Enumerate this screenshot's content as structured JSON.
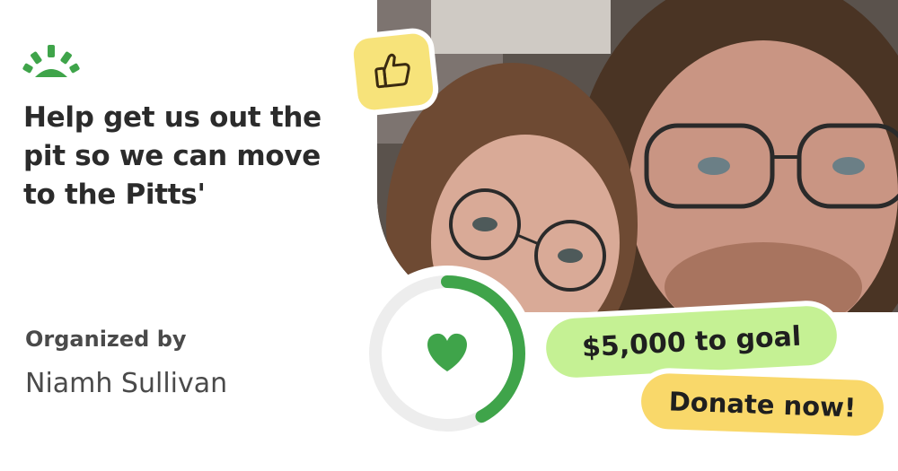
{
  "brand": {
    "logo_icon": "sunrise-logo-icon",
    "accent": "#3fa44a"
  },
  "campaign": {
    "title": "Help get us out the pit so we can move to the Pitts'",
    "organized_by_label": "Organized by",
    "organizer": "Niamh Sullivan",
    "photo_icon": "campaign-photo"
  },
  "progress": {
    "fraction": 0.42,
    "color": "#3fa44a",
    "track": "#ededed",
    "icon": "heart-icon"
  },
  "goal": {
    "label": "$5,000 to goal",
    "color": "#c5f194"
  },
  "donate": {
    "label": "Donate now!",
    "color": "#f9d86a"
  },
  "badge": {
    "icon": "thumbs-up-icon",
    "color": "#f7e37a"
  }
}
